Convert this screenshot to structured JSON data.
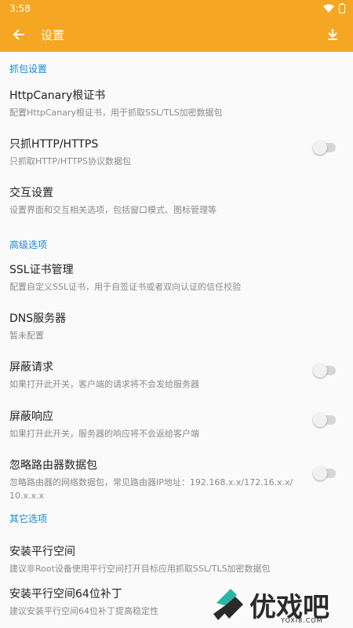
{
  "status": {
    "time": "3:58"
  },
  "app_bar": {
    "title": "设置",
    "back_icon": "arrow-left-icon",
    "download_icon": "download-icon"
  },
  "colors": {
    "accent": "#f5a623",
    "section": "#1a88d7"
  },
  "sections": [
    {
      "header": "抓包设置",
      "items": [
        {
          "title": "HttpCanary根证书",
          "summary": "配置HttpCanary根证书，用于抓取SSL/TLS加密数据包",
          "switch": null
        },
        {
          "title": "只抓HTTP/HTTPS",
          "summary": "只抓取HTTP/HTTPS协议数据包",
          "switch": false
        },
        {
          "title": "交互设置",
          "summary": "设置界面和交互相关选项，包括窗口模式、图标管理等",
          "switch": null
        }
      ]
    },
    {
      "header": "高级选项",
      "items": [
        {
          "title": "SSL证书管理",
          "summary": "配置自定义SSL证书，用于自签证书或者双向认证的信任校验",
          "switch": null
        },
        {
          "title": "DNS服务器",
          "summary": "暂未配置",
          "switch": null
        },
        {
          "title": "屏蔽请求",
          "summary": "如果打开此开关，客户端的请求将不会发给服务器",
          "switch": false
        },
        {
          "title": "屏蔽响应",
          "summary": "如果打开此开关，服务器的响应将不会返给客户端",
          "switch": false
        },
        {
          "title": "忽略路由器数据包",
          "summary": "忽略路由器的网络数据包，常见路由器IP地址：192.168.x.x/172.16.x.x/",
          "summary2": "10.x.x.x",
          "switch": false
        }
      ]
    },
    {
      "header": "其它选项",
      "items": [
        {
          "title": "安装平行空间",
          "summary": "建议非Root设备使用平行空间打开目标应用抓取SSL/TLS加密数据包",
          "switch": null
        },
        {
          "title": "安装平行空间64位补丁",
          "summary": "建议安装平行空间64位补丁提高稳定性",
          "switch": null
        }
      ]
    }
  ],
  "watermark": {
    "text": "优戏吧",
    "sub": "YOXI8.COM"
  }
}
